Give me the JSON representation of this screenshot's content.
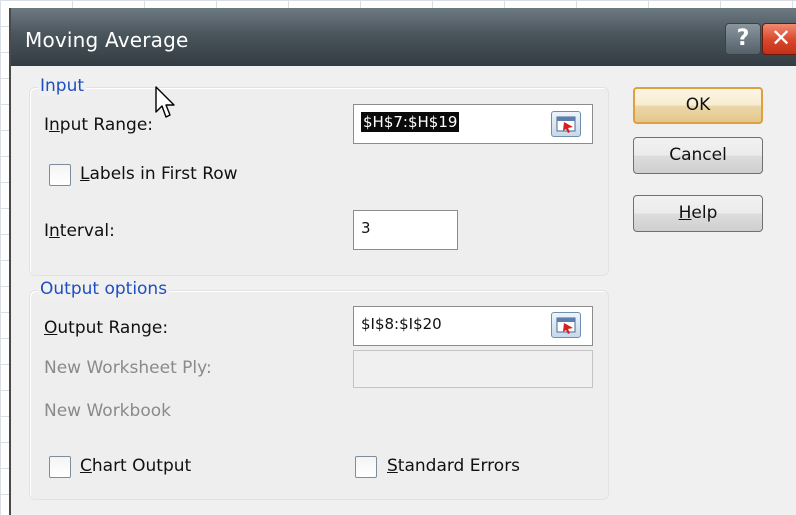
{
  "dialog": {
    "title": "Moving Average",
    "help_glyph": "?",
    "close_glyph": "✕"
  },
  "input_group": {
    "title": "Input",
    "input_range_label_pre": "I",
    "input_range_label_ul": "n",
    "input_range_label_post": "put Range:",
    "input_range_value": "$H$7:$H$19",
    "labels_first_row_ul": "L",
    "labels_first_row_post": "abels in First Row",
    "interval_label_pre": "I",
    "interval_label_ul": "n",
    "interval_label_post": "terval:",
    "interval_value": "3"
  },
  "output_group": {
    "title": "Output options",
    "output_range_label_ul": "O",
    "output_range_label_post": "utput Range:",
    "output_range_value": "$I$8:$I$20",
    "new_worksheet_label": "New Worksheet Ply:",
    "new_workbook_label": "New Workbook",
    "chart_output_ul": "C",
    "chart_output_post": "hart Output",
    "standard_errors_ul": "S",
    "standard_errors_post": "tandard Errors"
  },
  "buttons": {
    "ok": "OK",
    "cancel": "Cancel",
    "help_ul": "H",
    "help_post": "elp"
  },
  "icons": {
    "range_select": "collapse-dialog-icon",
    "cursor": "mouse-pointer-icon"
  },
  "colors": {
    "group_title": "#1f4fbf",
    "titlebar": "#4a555c",
    "close": "#d9452a"
  }
}
